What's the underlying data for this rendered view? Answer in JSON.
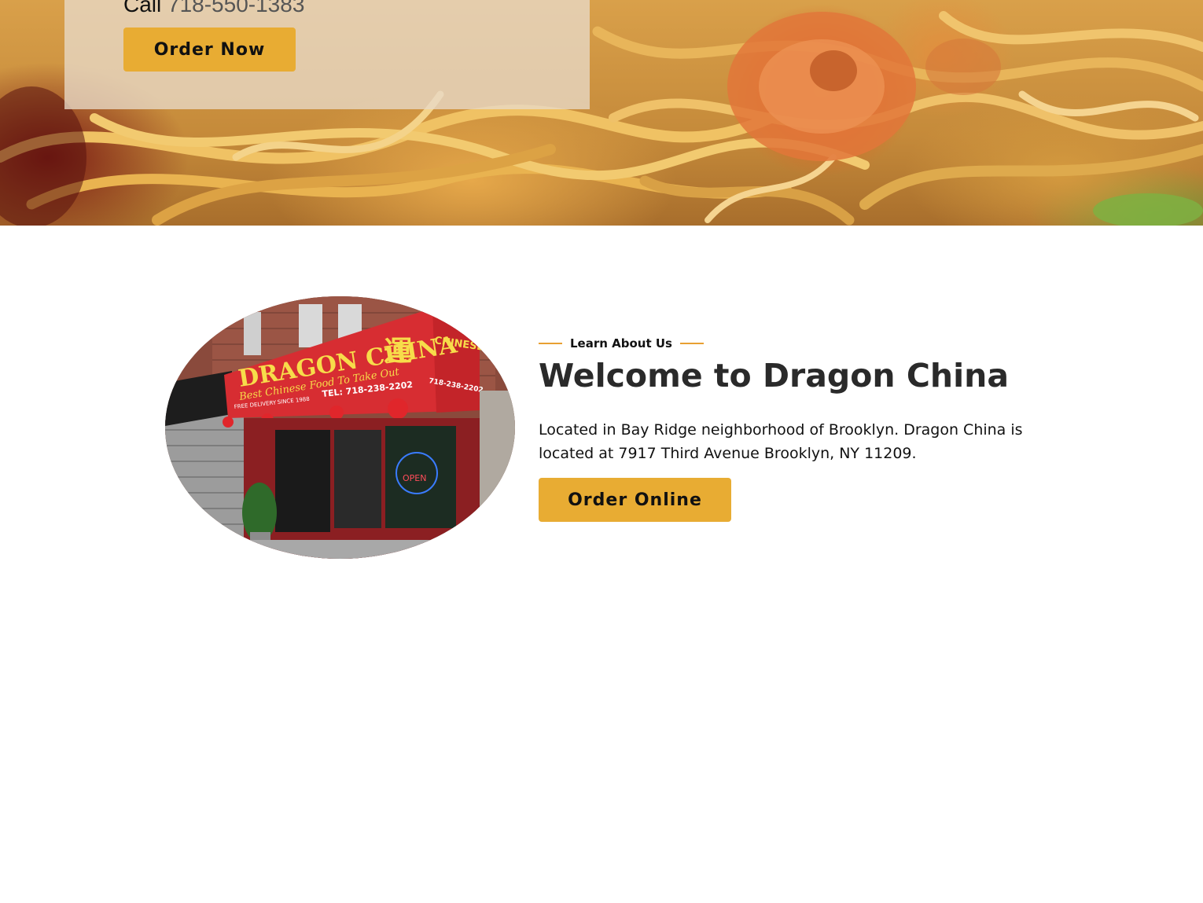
{
  "hero": {
    "call_prefix": "Call",
    "phone": "718-550-1383",
    "order_now_label": "Order Now"
  },
  "about": {
    "eyebrow": "Learn About Us",
    "title": "Welcome to Dragon China",
    "description": "Located in Bay Ridge neighborhood of Brooklyn. Dragon China is located at 7917 Third Avenue Brooklyn, NY 11209.",
    "order_online_label": "Order Online",
    "photo": {
      "awning_name": "DRAGON CHINA",
      "awning_char": "運",
      "awning_tagline": "Best Chinese Food To Take Out",
      "awning_tel": "TEL: 718-238-2202",
      "free_delivery": "FREE DELIVERY",
      "since": "SINCE 1988",
      "side_sign": "CHINESE FOOD",
      "side_tel": "718-238-2202",
      "neon_open": "OPEN"
    }
  },
  "colors": {
    "accent": "#e8ac33",
    "eyebrow_line": "#e8a032",
    "heading": "#2a2a2a"
  }
}
